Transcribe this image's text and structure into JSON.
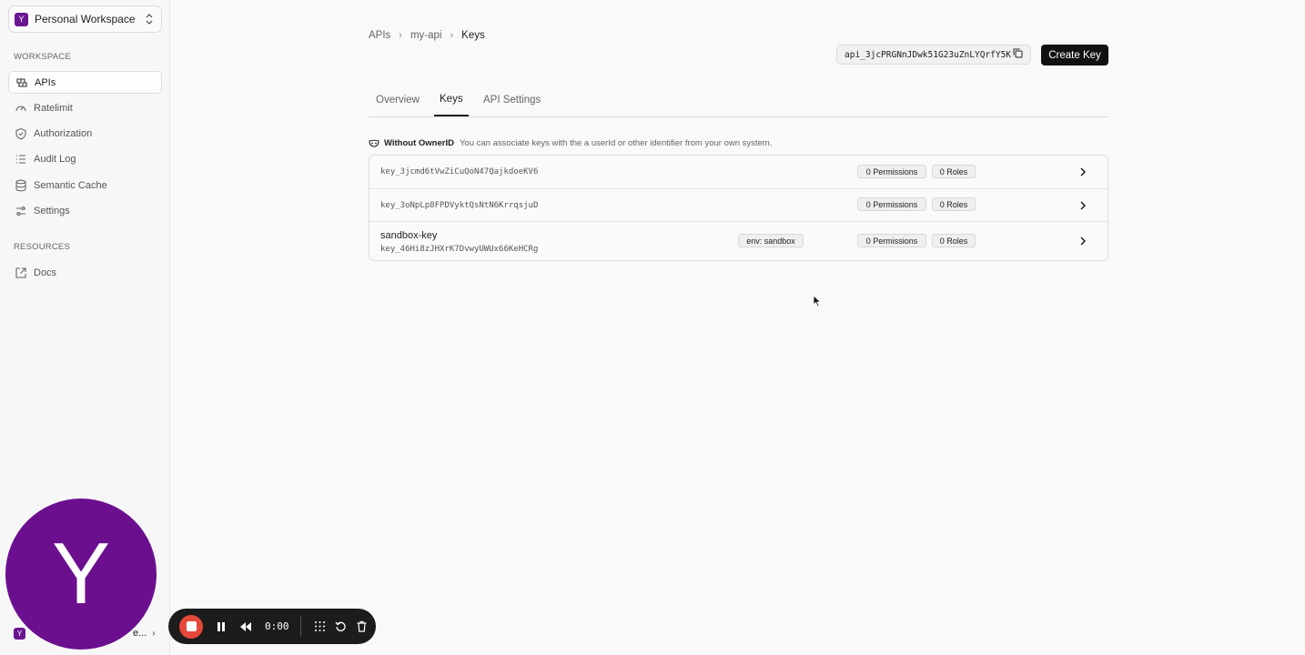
{
  "sidebar": {
    "workspace_logo": "Y",
    "workspace_name": "Personal Workspace",
    "workspace_label": "WORKSPACE",
    "workspace_items": [
      {
        "label": "APIs",
        "icon": "apis-icon",
        "active": true
      },
      {
        "label": "Ratelimit",
        "icon": "gauge-icon"
      },
      {
        "label": "Authorization",
        "icon": "shield-icon"
      },
      {
        "label": "Audit Log",
        "icon": "list-icon"
      },
      {
        "label": "Semantic Cache",
        "icon": "database-icon"
      },
      {
        "label": "Settings",
        "icon": "settings-icon"
      }
    ],
    "resources_label": "RESOURCES",
    "resources_items": [
      {
        "label": "Docs",
        "icon": "external-link-icon"
      }
    ],
    "avatar_letter": "Y",
    "user_logo": "Y",
    "user_name_visible": "e..."
  },
  "recorder": {
    "time": "0:00"
  },
  "breadcrumb": [
    "APIs",
    "my-api",
    "Keys"
  ],
  "api_id": "api_3jcPRGNnJDwk51G23uZnLYQrfY5K",
  "create_key_label": "Create Key",
  "tabs": [
    {
      "label": "Overview"
    },
    {
      "label": "Keys",
      "active": true
    },
    {
      "label": "API Settings"
    }
  ],
  "owner_note": {
    "title": "Without OwnerID",
    "text": "You can associate keys with the a userId or other identifier from your own system."
  },
  "keys": [
    {
      "name": "",
      "id": "key_3jcmd6tVwZiCuQoN47QajkdoeKV6",
      "env": "",
      "permissions": "0 Permissions",
      "roles": "0 Roles"
    },
    {
      "name": "",
      "id": "key_3oNpLp8FPDVyktQsNtN6KrrqsjuD",
      "env": "",
      "permissions": "0 Permissions",
      "roles": "0 Roles"
    },
    {
      "name": "sandbox-key",
      "id": "key_46Hi8zJHXrK7DvwyUWUx66KeHCRg",
      "env": "env: sandbox",
      "permissions": "0 Permissions",
      "roles": "0 Roles"
    }
  ]
}
